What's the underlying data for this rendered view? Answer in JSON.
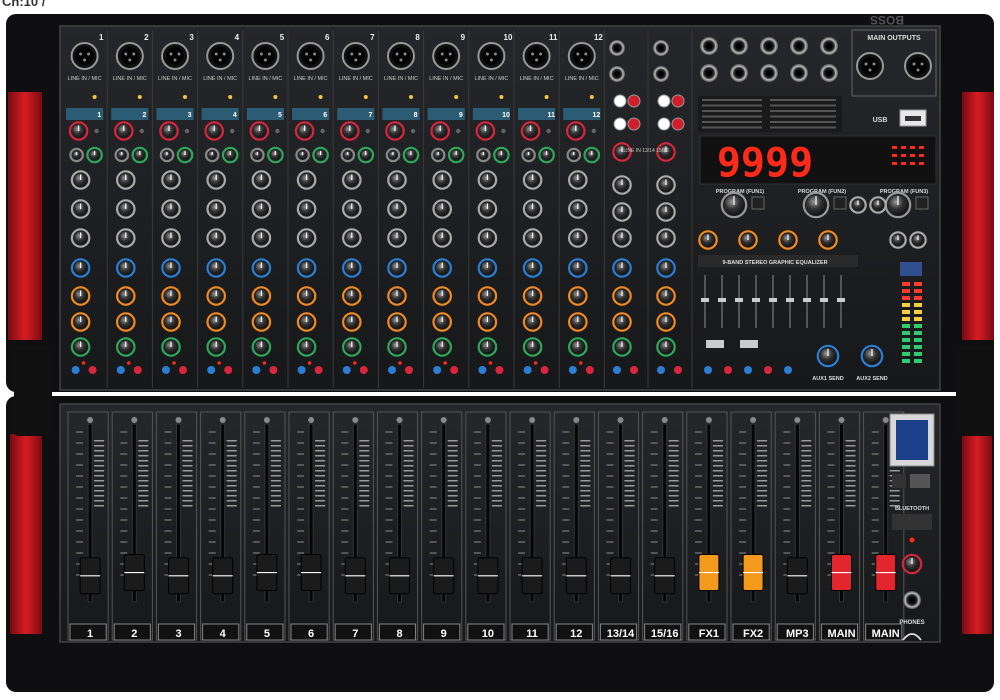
{
  "header_fragment": "Ch:10 /",
  "brand_mark": "BOSS",
  "display_value": "9999",
  "channels": [
    {
      "num": "1",
      "input_label": "LINE IN / MIC"
    },
    {
      "num": "2",
      "input_label": "LINE IN / MIC"
    },
    {
      "num": "3",
      "input_label": "LINE IN / MIC"
    },
    {
      "num": "4",
      "input_label": "LINE IN / MIC"
    },
    {
      "num": "5",
      "input_label": "LINE IN / MIC"
    },
    {
      "num": "6",
      "input_label": "LINE IN / MIC"
    },
    {
      "num": "7",
      "input_label": "LINE IN / MIC"
    },
    {
      "num": "8",
      "input_label": "LINE IN / MIC"
    },
    {
      "num": "9",
      "input_label": "LINE IN / MIC"
    },
    {
      "num": "10",
      "input_label": "LINE IN / MIC"
    },
    {
      "num": "11",
      "input_label": "LINE IN / MIC"
    },
    {
      "num": "12",
      "input_label": "LINE IN / MIC"
    }
  ],
  "stereo_label": "LINE IN 13/14 15/16",
  "main_outputs_label": "MAIN OUTPUTS",
  "usb_label": "USB",
  "program_labels": [
    "PROGRAM (FUN1)",
    "PROGRAM (FUN2)",
    "PROGRAM (FUN3)"
  ],
  "eq_label": "9-BAND STEREO GRAPHIC EQUALIZER",
  "aux_send_labels": [
    "AUX1 SEND",
    "AUX2 SEND"
  ],
  "fader_labels": [
    "1",
    "2",
    "3",
    "4",
    "5",
    "6",
    "7",
    "8",
    "9",
    "10",
    "11",
    "12",
    "13/14",
    "15/16",
    "FX1",
    "FX2",
    "MP3",
    "MAIN",
    "MAIN"
  ],
  "fader_cap_colors": [
    "#1b1b1b",
    "#1b1b1b",
    "#1b1b1b",
    "#1b1b1b",
    "#1b1b1b",
    "#1b1b1b",
    "#1b1b1b",
    "#1b1b1b",
    "#1b1b1b",
    "#1b1b1b",
    "#1b1b1b",
    "#1b1b1b",
    "#1b1b1b",
    "#1b1b1b",
    "#f39a1d",
    "#f39a1d",
    "#1b1b1b",
    "#e3262e",
    "#e3262e"
  ],
  "fader_levels": [
    0.1,
    0.12,
    0.1,
    0.1,
    0.12,
    0.12,
    0.1,
    0.1,
    0.1,
    0.1,
    0.1,
    0.1,
    0.1,
    0.1,
    0.12,
    0.12,
    0.1,
    0.12,
    0.12
  ],
  "bluetooth_label": "BLUETOOTH",
  "phones_label": "PHONES",
  "colors": {
    "panel": "#1d1e20",
    "frame": "#121214",
    "side_red": "#c8161d",
    "knob_red": "#d7263d",
    "knob_green": "#2ea85a",
    "knob_blue": "#2a7fd4",
    "knob_orange": "#f08a24",
    "led_red": "#ff2a1a"
  }
}
